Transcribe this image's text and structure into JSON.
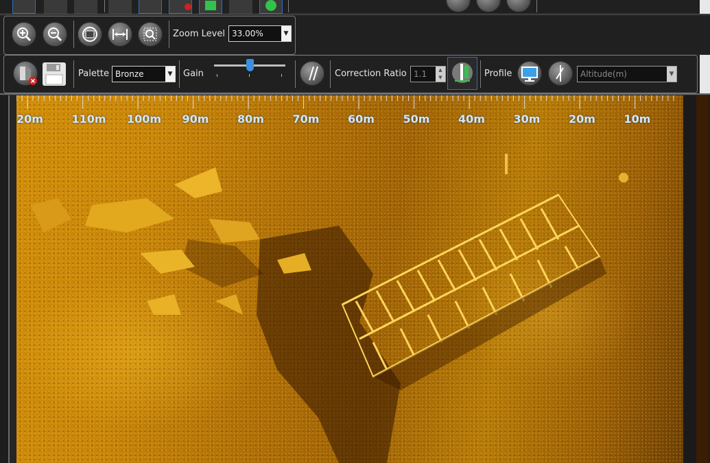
{
  "zoom_toolbar": {
    "zoom_level_label": "Zoom Level",
    "zoom_level_value": "33.00%"
  },
  "main_toolbar": {
    "palette_label": "Palette",
    "palette_value": "Bronze",
    "gain_label": "Gain",
    "gain_level": 0.5,
    "correction_ratio_label": "Correction Ratio",
    "correction_ratio_value": "1.1",
    "profile_label": "Profile",
    "altitude_placeholder": "Altitude(m)"
  },
  "range_scale": {
    "unit": "m",
    "labels": [
      "20m",
      "110m",
      "100m",
      "90m",
      "80m",
      "70m",
      "60m",
      "50m",
      "40m",
      "30m",
      "20m",
      "10m"
    ]
  },
  "colors": {
    "toolbar_bg": "#202020",
    "accent_blue": "#2f6fb5",
    "accent_green": "#33c24a",
    "sonar_bronze": "#c98507",
    "scale_text": "#cfe8ff"
  }
}
